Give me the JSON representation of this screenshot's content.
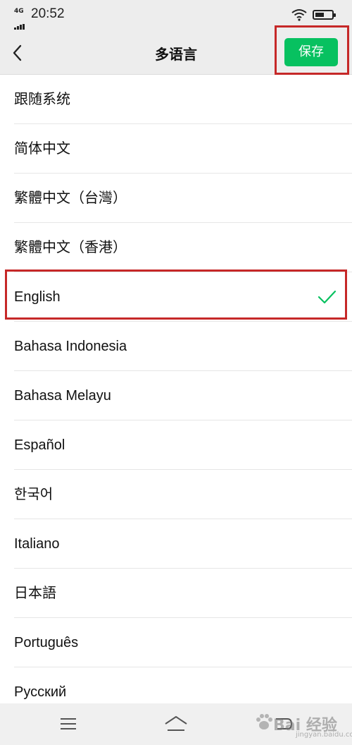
{
  "status_bar": {
    "network": "4G",
    "time": "20:52",
    "icons": [
      "signal-icon",
      "wifi-icon",
      "battery-icon"
    ]
  },
  "header": {
    "back_icon": "chevron-left-icon",
    "title": "多语言",
    "save_label": "保存"
  },
  "languages": [
    {
      "label": "跟随系统",
      "selected": false
    },
    {
      "label": "简体中文",
      "selected": false
    },
    {
      "label": "繁體中文（台灣）",
      "selected": false
    },
    {
      "label": "繁體中文（香港）",
      "selected": false
    },
    {
      "label": "English",
      "selected": true
    },
    {
      "label": "Bahasa Indonesia",
      "selected": false
    },
    {
      "label": "Bahasa Melayu",
      "selected": false
    },
    {
      "label": "Español",
      "selected": false
    },
    {
      "label": "한국어",
      "selected": false
    },
    {
      "label": "Italiano",
      "selected": false
    },
    {
      "label": "日本語",
      "selected": false
    },
    {
      "label": "Português",
      "selected": false
    },
    {
      "label": "Русский",
      "selected": false
    }
  ],
  "bottom_nav": {
    "icons": [
      "menu-icon",
      "home-icon",
      "back-icon"
    ]
  },
  "watermark": {
    "text": "Bai 经验",
    "url": "jingyan.baidu.com"
  },
  "colors": {
    "accent_green": "#07c160",
    "annotation_red": "#c62828",
    "header_bg": "#ededed"
  }
}
